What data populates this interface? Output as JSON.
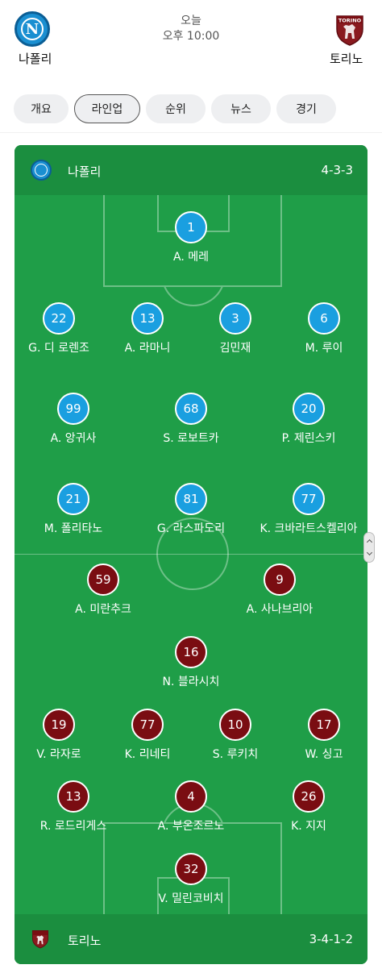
{
  "header": {
    "home_team": "나폴리",
    "away_team": "토리노",
    "day": "오늘",
    "time": "오후 10:00",
    "home_logo_letter": "N",
    "away_logo_text": "TORINO"
  },
  "tabs": [
    {
      "label": "개요",
      "active": false
    },
    {
      "label": "라인업",
      "active": true
    },
    {
      "label": "순위",
      "active": false
    },
    {
      "label": "뉴스",
      "active": false
    },
    {
      "label": "경기",
      "active": false
    }
  ],
  "lineup": {
    "home": {
      "team": "나폴리",
      "formation": "4-3-3",
      "color": "#1a9fe0",
      "players": [
        {
          "number": "1",
          "name": "A. 메레"
        },
        {
          "number": "22",
          "name": "G. 디 로렌조"
        },
        {
          "number": "13",
          "name": "A. 라마니"
        },
        {
          "number": "3",
          "name": "김민재"
        },
        {
          "number": "6",
          "name": "M. 루이"
        },
        {
          "number": "99",
          "name": "A. 앙귀사"
        },
        {
          "number": "68",
          "name": "S. 로보트카"
        },
        {
          "number": "20",
          "name": "P. 제린스키"
        },
        {
          "number": "21",
          "name": "M. 폴리타노"
        },
        {
          "number": "81",
          "name": "G. 라스파도리"
        },
        {
          "number": "77",
          "name": "K. 크바라트스켈리아"
        }
      ]
    },
    "away": {
      "team": "토리노",
      "formation": "3-4-1-2",
      "color": "#7a0d12",
      "players": [
        {
          "number": "59",
          "name": "A. 미란추크"
        },
        {
          "number": "9",
          "name": "A. 사나브리아"
        },
        {
          "number": "16",
          "name": "N. 블라시치"
        },
        {
          "number": "19",
          "name": "V. 라자로"
        },
        {
          "number": "77",
          "name": "K. 리네티"
        },
        {
          "number": "10",
          "name": "S. 루키치"
        },
        {
          "number": "17",
          "name": "W. 싱고"
        },
        {
          "number": "13",
          "name": "R. 로드리게스"
        },
        {
          "number": "4",
          "name": "A. 부온조르노"
        },
        {
          "number": "26",
          "name": "K. 지지"
        },
        {
          "number": "32",
          "name": "V. 밀린코비치"
        }
      ]
    }
  },
  "icons": {
    "home_logo": "napoli-crest-icon",
    "away_logo": "torino-crest-icon",
    "scroll": "scroll-handle-icon"
  }
}
